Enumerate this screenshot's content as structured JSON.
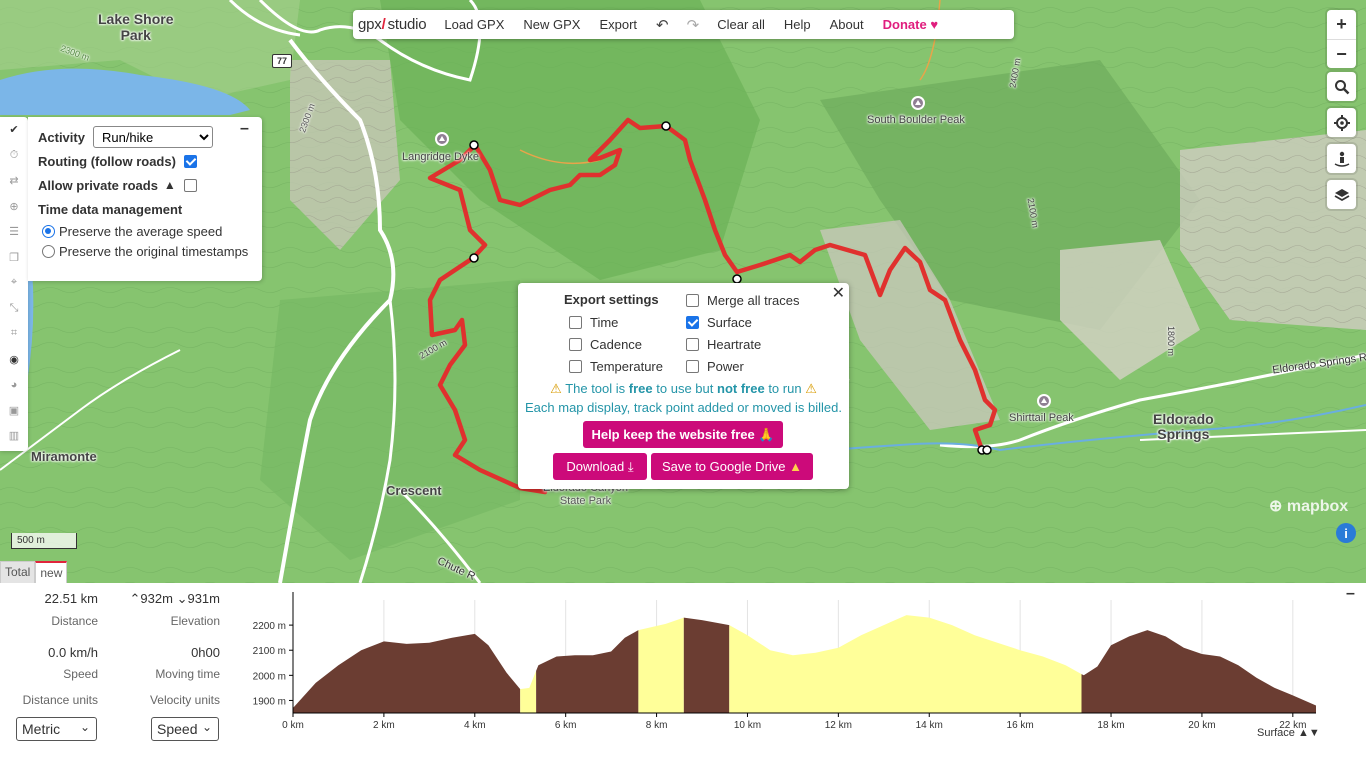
{
  "toolbar": {
    "logo_prefix": "gpx",
    "logo_suffix": "studio",
    "menu": [
      "Load GPX",
      "New GPX",
      "Export"
    ],
    "undo_icon": "undo-icon",
    "redo_icon": "redo-icon",
    "clear_all": "Clear all",
    "help": "Help",
    "about": "About",
    "donate": "Donate"
  },
  "map_labels": {
    "lake_shore_park": "Lake Shore\nPark",
    "langridge": "Langridge Dyke",
    "south_boulder_peak": "South Boulder Peak",
    "shirttail_peak": "Shirttail Peak",
    "eldorado_springs": "Eldorado\nSprings",
    "eldorado_springs_road": "Eldorado Springs R",
    "miramonte": "Miramonte",
    "crescent": "Crescent",
    "eldorado_canyon": "Eldorado Canyon\nState Park",
    "chute_road": "Chute R",
    "road_shield": "77",
    "contour_2300_a": "2300 m",
    "contour_2300_b": "2300 m",
    "contour_2100_a": "2100 m",
    "contour_2100_b": "2100 m",
    "contour_2400": "2400 m",
    "contour_1800": "1800 m"
  },
  "map_controls": {
    "zoom_in": "+",
    "zoom_out": "−"
  },
  "routing": {
    "activity_label": "Activity",
    "activity_value": "Run/hike",
    "routing_label": "Routing (follow roads)",
    "routing_checked": true,
    "private_label": "Allow private roads",
    "private_checked": false,
    "time_label": "Time data management",
    "option_avg": "Preserve the average speed",
    "option_orig": "Preserve the original timestamps",
    "selected": "avg"
  },
  "export": {
    "title": "Export settings",
    "merge": "Merge all traces",
    "time": "Time",
    "surface": "Surface",
    "cadence": "Cadence",
    "heartrate": "Heartrate",
    "temperature": "Temperature",
    "power": "Power",
    "surface_checked": true,
    "warn_a": "The tool is",
    "warn_free": "free",
    "warn_b": "to use but",
    "warn_notfree": "not free",
    "warn_c": "to run",
    "warn2": "Each map display, track point added or moved is billed.",
    "help_btn": "Help keep the website free 🙏",
    "download_btn": "Download",
    "drive_btn": "Save to Google Drive"
  },
  "attribution": {
    "mapbox": "mapbox",
    "info": "i",
    "scale": "500 m"
  },
  "tabs": [
    "Total",
    "new"
  ],
  "stats": {
    "distance_value": "22.51 km",
    "distance_label": "Distance",
    "elev_up": "932m",
    "elev_down": "931m",
    "elevation_label": "Elevation",
    "speed_value": "0.0 km/h",
    "speed_label": "Speed",
    "moving_value": "0h00",
    "moving_label": "Moving time",
    "dist_units_label": "Distance units",
    "vel_units_label": "Velocity units",
    "dist_units": "Metric",
    "vel_units": "Speed"
  },
  "chart_data": {
    "type": "area",
    "xlabel": "",
    "ylabel": "",
    "x_unit": "km",
    "xlim": [
      0,
      22.51
    ],
    "ylim": [
      1850,
      2300
    ],
    "x_ticks": [
      "0 km",
      "2 km",
      "4 km",
      "6 km",
      "8 km",
      "10 km",
      "12 km",
      "14 km",
      "16 km",
      "18 km",
      "20 km",
      "22 km"
    ],
    "y_ticks": [
      "1900 m",
      "2000 m",
      "2100 m",
      "2200 m"
    ],
    "legend": "Surface",
    "colors": {
      "unpaved": "#6b3d32",
      "paved": "#ffff99"
    },
    "x": [
      0,
      0.5,
      1.0,
      1.5,
      2.0,
      2.5,
      3.0,
      3.5,
      4.0,
      4.3,
      4.7,
      5.0,
      5.2,
      5.4,
      5.8,
      6.2,
      6.6,
      7.0,
      7.3,
      7.6,
      8.2,
      8.6,
      9.0,
      9.3,
      9.6,
      10.0,
      10.5,
      11.0,
      11.5,
      12.0,
      12.5,
      13.0,
      13.5,
      14.0,
      14.5,
      15.0,
      15.5,
      16.0,
      16.5,
      17.0,
      17.4,
      17.7,
      18.0,
      18.4,
      18.8,
      19.2,
      19.6,
      20.0,
      20.4,
      20.8,
      21.2,
      21.6,
      22.0,
      22.51
    ],
    "values": [
      1870,
      1970,
      2040,
      2100,
      2135,
      2125,
      2130,
      2150,
      2165,
      2120,
      2010,
      1945,
      1950,
      2040,
      2075,
      2080,
      2080,
      2095,
      2150,
      2180,
      2205,
      2230,
      2220,
      2210,
      2200,
      2160,
      2100,
      2080,
      2090,
      2110,
      2160,
      2200,
      2240,
      2230,
      2200,
      2160,
      2130,
      2100,
      2075,
      2040,
      2000,
      2035,
      2120,
      2155,
      2180,
      2155,
      2110,
      2085,
      2075,
      2040,
      1990,
      1950,
      1920,
      1880
    ],
    "surface_segments": [
      {
        "from": 0,
        "to": 5.0,
        "surface": "unpaved"
      },
      {
        "from": 5.0,
        "to": 5.35,
        "surface": "paved"
      },
      {
        "from": 5.35,
        "to": 7.6,
        "surface": "unpaved"
      },
      {
        "from": 7.6,
        "to": 8.6,
        "surface": "paved"
      },
      {
        "from": 8.6,
        "to": 9.6,
        "surface": "unpaved"
      },
      {
        "from": 9.6,
        "to": 17.35,
        "surface": "paved"
      },
      {
        "from": 17.35,
        "to": 22.51,
        "surface": "unpaved"
      }
    ]
  }
}
